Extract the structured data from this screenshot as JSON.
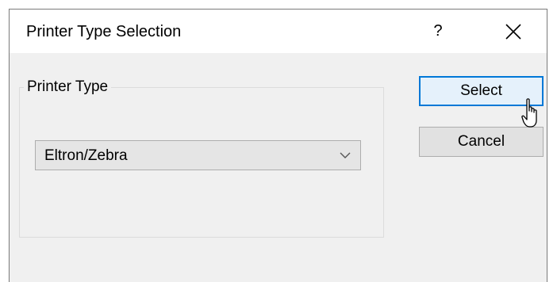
{
  "dialog": {
    "title": "Printer Type Selection",
    "help_label": "?",
    "close_icon": "close-icon"
  },
  "printer_type": {
    "legend": "Printer Type",
    "selected": "Eltron/Zebra",
    "arrow_icon": "chevron-down-icon"
  },
  "buttons": {
    "select_label": "Select",
    "cancel_label": "Cancel"
  },
  "colors": {
    "dialog_bg": "#f0f0f0",
    "titlebar_bg": "#ffffff",
    "focus_accent": "#0078d7",
    "hover_bg": "#e5f1fb"
  },
  "cursor_icon": "hand-pointer-cursor-icon"
}
